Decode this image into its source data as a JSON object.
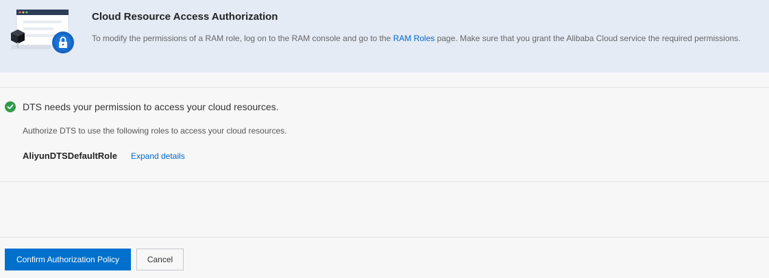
{
  "colors": {
    "banner_bg": "#e4ebf5",
    "link": "#0066cc",
    "primary_button": "#0070cc",
    "success": "#2e9c47"
  },
  "banner": {
    "icon": "cloud-lock-illustration",
    "title": "Cloud Resource Access Authorization",
    "desc_prefix": "To modify the permissions of a RAM role, log on to the RAM console and go to the ",
    "desc_link": "RAM Roles",
    "desc_suffix": " page. Make sure that you grant the Alibaba Cloud service the required permissions."
  },
  "permission": {
    "icon": "check-circle-icon",
    "status": "DTS needs your permission to access your cloud resources.",
    "instruction": "Authorize DTS to use the following roles to access your cloud resources.",
    "role_name": "AliyunDTSDefaultRole",
    "expand_label": "Expand details"
  },
  "footer": {
    "confirm_label": "Confirm Authorization Policy",
    "cancel_label": "Cancel"
  }
}
